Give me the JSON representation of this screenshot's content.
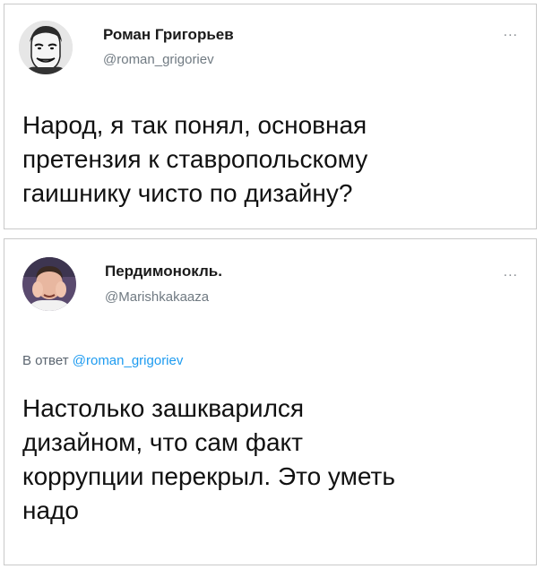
{
  "tweets": [
    {
      "author_name": "Роман Григорьев",
      "handle": "@roman_grigoriev",
      "more_label": "...",
      "avatar_icon": "meme-face-avatar",
      "text": "Народ, я так понял, основная\nпретензия к ставропольскому\nгаишнику чисто по дизайну?"
    },
    {
      "author_name": "Пердимонокль.",
      "handle": "@Marishkakaaza",
      "more_label": "...",
      "avatar_icon": "photo-avatar",
      "reply_prefix": "В ответ",
      "reply_to": "@roman_grigoriev",
      "text": "Настолько зашкварился\nдизайном, что сам факт\nкоррупции перекрыл. Это уметь\nнадо"
    }
  ],
  "colors": {
    "link": "#1d9bf0",
    "handle": "#707a82",
    "border": "#c9c9c9"
  }
}
